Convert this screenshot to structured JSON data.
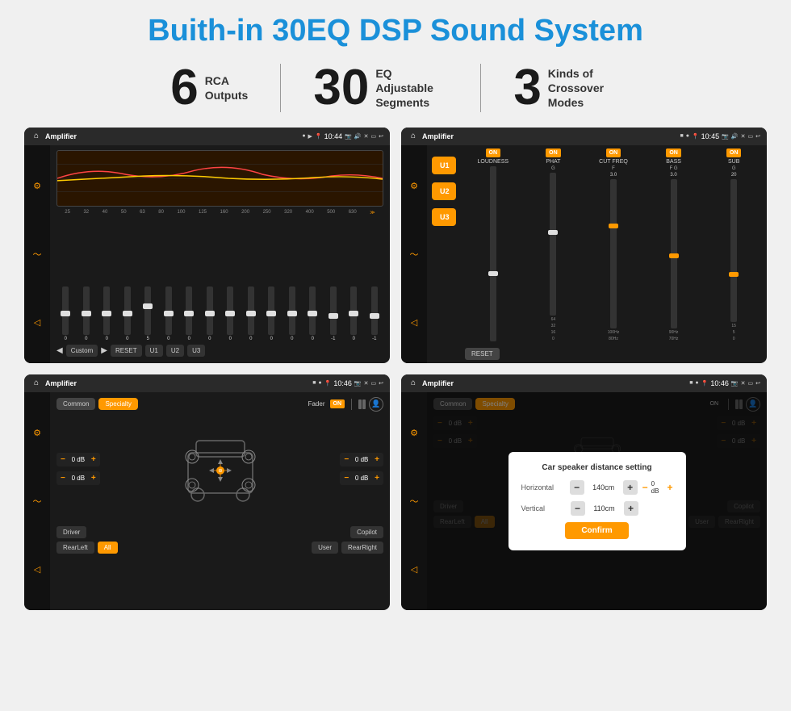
{
  "header": {
    "title": "Buith-in 30EQ DSP Sound System"
  },
  "stats": [
    {
      "number": "6",
      "label": "RCA\nOutputs"
    },
    {
      "number": "30",
      "label": "EQ Adjustable\nSegments"
    },
    {
      "number": "3",
      "label": "Kinds of\nCrossover Modes"
    }
  ],
  "screens": [
    {
      "id": "eq-screen",
      "title": "Amplifier",
      "time": "10:44",
      "type": "eq"
    },
    {
      "id": "crossover-screen",
      "title": "Amplifier",
      "time": "10:45",
      "type": "crossover"
    },
    {
      "id": "fader-screen",
      "title": "Amplifier",
      "time": "10:46",
      "type": "fader"
    },
    {
      "id": "distance-screen",
      "title": "Amplifier",
      "time": "10:46",
      "type": "distance",
      "modal": {
        "title": "Car speaker distance setting",
        "horizontal": {
          "label": "Horizontal",
          "value": "140cm"
        },
        "vertical": {
          "label": "Vertical",
          "value": "110cm"
        },
        "confirm": "Confirm"
      }
    }
  ],
  "eq": {
    "frequencies": [
      "25",
      "32",
      "40",
      "50",
      "63",
      "80",
      "100",
      "125",
      "160",
      "200",
      "250",
      "320",
      "400",
      "500",
      "630"
    ],
    "values": [
      "0",
      "0",
      "0",
      "0",
      "5",
      "0",
      "0",
      "0",
      "0",
      "0",
      "0",
      "0",
      "0",
      "-1",
      "0",
      "-1"
    ],
    "presets": [
      "Custom",
      "RESET",
      "U1",
      "U2",
      "U3"
    ]
  },
  "crossover": {
    "presets": [
      "U1",
      "U2",
      "U3"
    ],
    "controls": [
      "LOUDNESS",
      "PHAT",
      "CUT FREQ",
      "BASS",
      "SUB"
    ],
    "on_labels": [
      "ON",
      "ON",
      "ON",
      "ON",
      "ON"
    ],
    "reset": "RESET"
  },
  "fader": {
    "tabs": [
      "Common",
      "Specialty"
    ],
    "active_tab": "Specialty",
    "fader_label": "Fader",
    "on_btn": "ON",
    "db_values": [
      "0 dB",
      "0 dB",
      "0 dB",
      "0 dB"
    ],
    "bottom_buttons": [
      "Driver",
      "Copilot",
      "RearLeft",
      "All",
      "User",
      "RearRight"
    ]
  },
  "distance": {
    "tabs": [
      "Common",
      "Specialty"
    ],
    "modal": {
      "title": "Car speaker distance setting",
      "horizontal_label": "Horizontal",
      "horizontal_value": "140cm",
      "vertical_label": "Vertical",
      "vertical_value": "110cm",
      "confirm_label": "Confirm"
    },
    "bottom_buttons": [
      "Driver",
      "Copilot",
      "RearLeft",
      "All",
      "User",
      "RearRight"
    ]
  }
}
